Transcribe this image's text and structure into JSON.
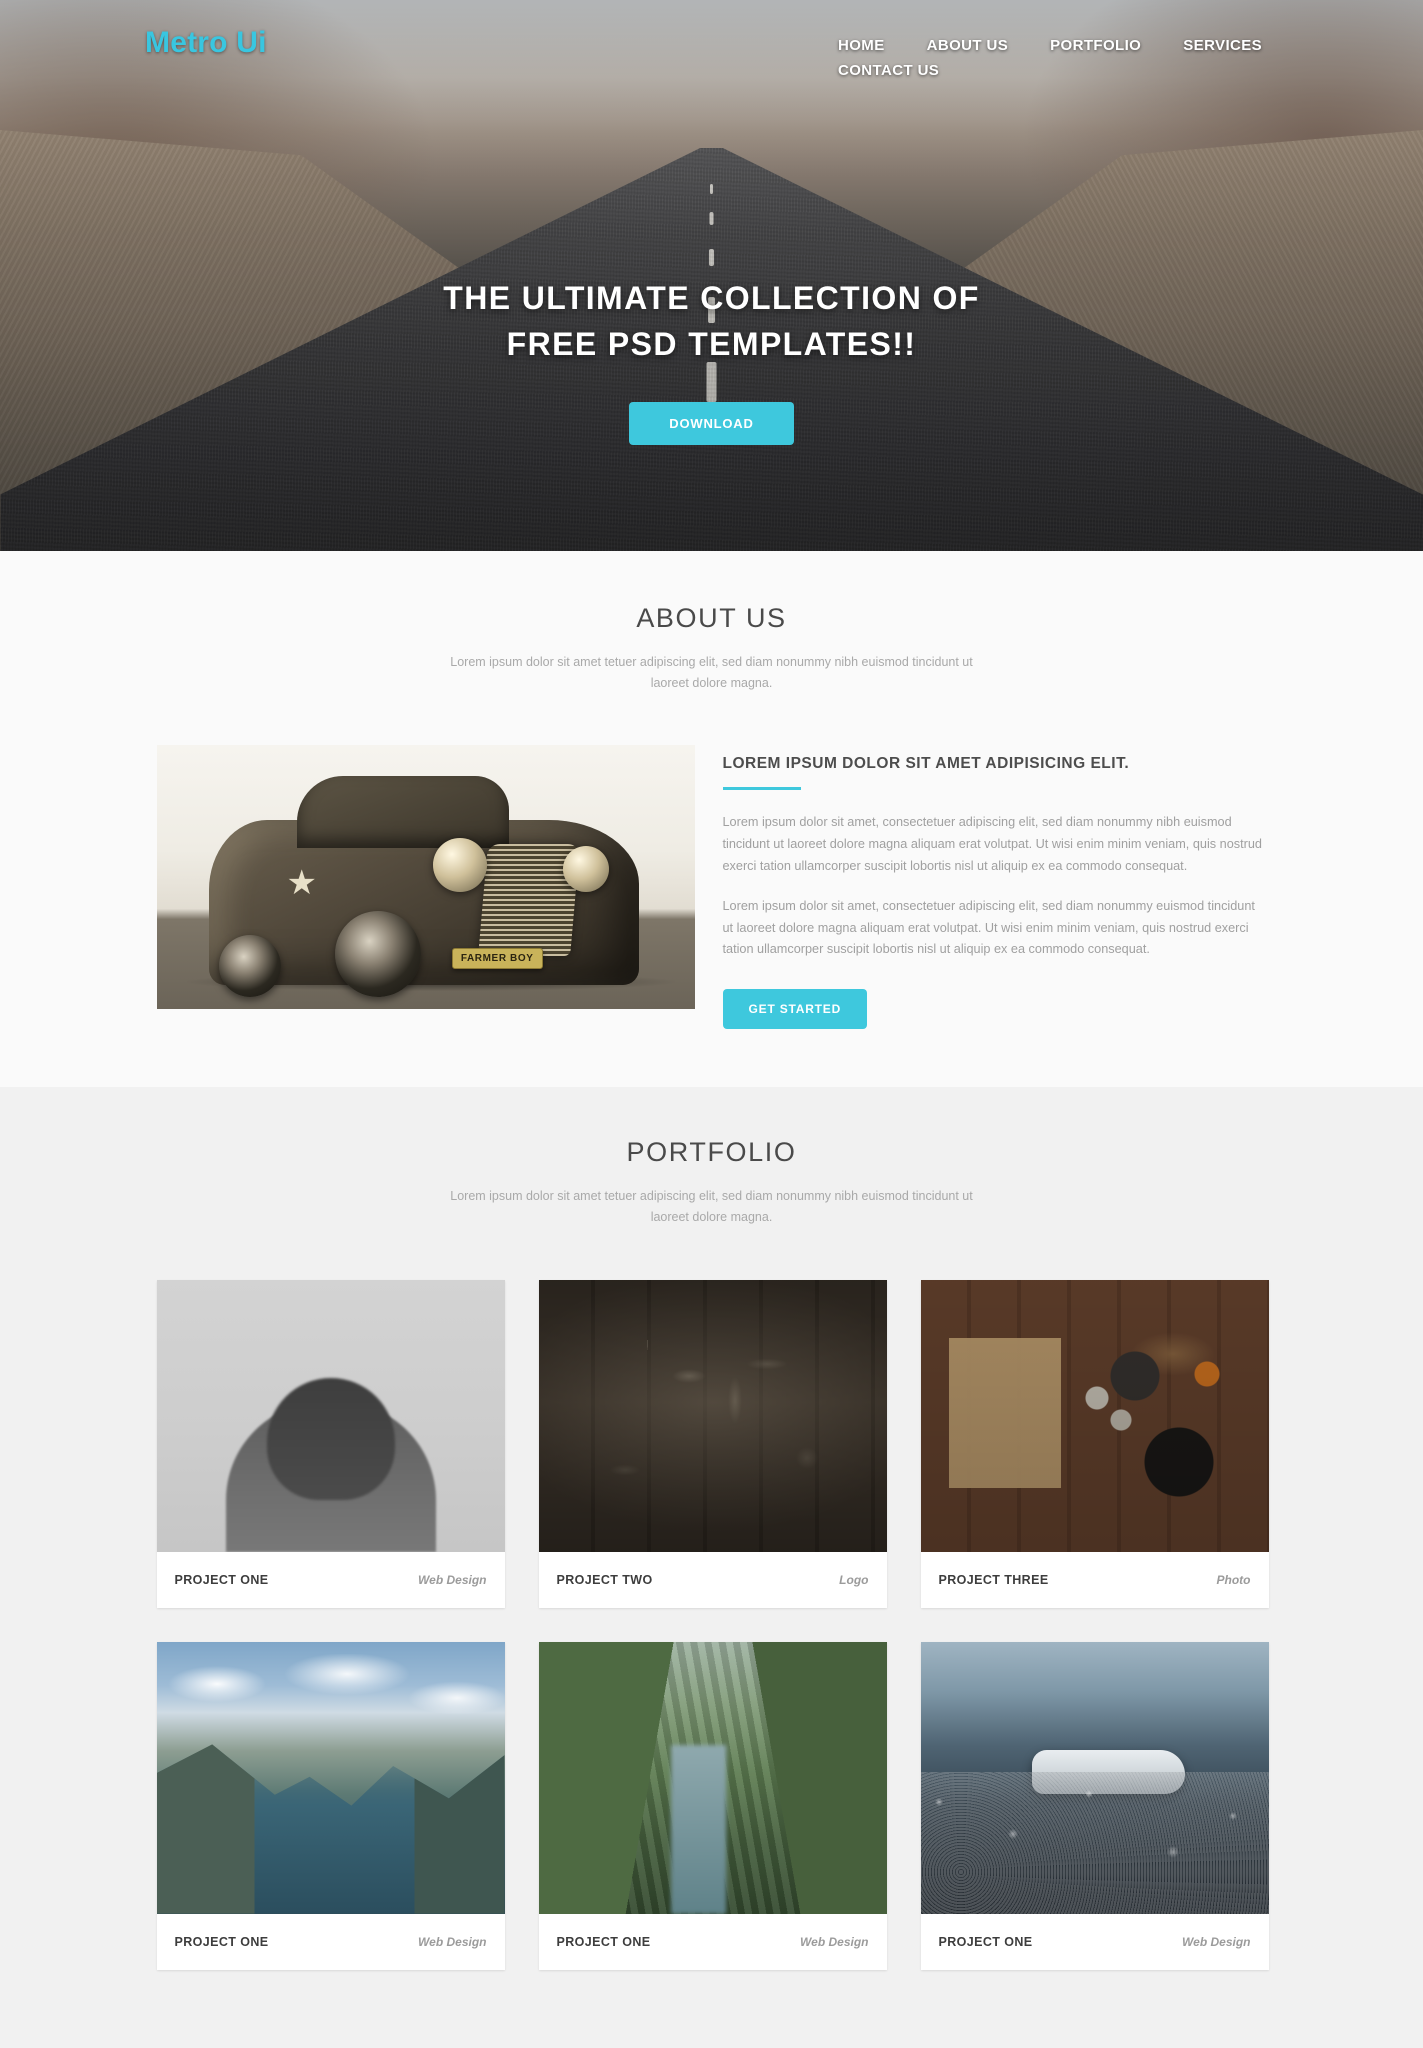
{
  "site": {
    "brand": "Metro Ui",
    "accent_color": "#3ec8dd",
    "nav": [
      {
        "label": "HOME"
      },
      {
        "label": "ABOUT US"
      },
      {
        "label": "PORTFOLIO"
      },
      {
        "label": "SERVICES"
      },
      {
        "label": "CONTACT US"
      }
    ]
  },
  "hero": {
    "title_line1": "THE ULTIMATE COLLECTION OF",
    "title_line2": "FREE PSD TEMPLATES!!",
    "cta_label": "DOWNLOAD"
  },
  "about": {
    "title": "ABOUT US",
    "subtitle": "Lorem ipsum dolor sit amet tetuer adipiscing elit, sed diam nonummy nibh euismod tincidunt ut laoreet dolore magna.",
    "image_caption": "FARMER BOY",
    "heading": "LOREM IPSUM DOLOR SIT AMET ADIPISICING ELIT.",
    "paragraph1": "Lorem ipsum dolor sit amet, consectetuer adipiscing elit, sed diam nonummy nibh euismod tincidunt ut laoreet dolore magna aliquam erat volutpat. Ut wisi enim minim veniam, quis nostrud exerci tation ullamcorper suscipit lobortis nisl ut aliquip ex ea commodo consequat.",
    "paragraph2": "Lorem ipsum dolor sit amet, consectetuer adipiscing elit, sed diam nonummy euismod tincidunt ut laoreet dolore magna aliquam erat volutpat. Ut wisi enim minim veniam, quis nostrud exerci tation ullamcorper suscipit lobortis nisl ut aliquip ex ea commodo consequat.",
    "cta_label": "GET STARTED"
  },
  "portfolio": {
    "title": "PORTFOLIO",
    "subtitle": "Lorem ipsum dolor sit amet tetuer adipiscing elit, sed diam nonummy nibh euismod tincidunt ut laoreet dolore magna.",
    "items": [
      {
        "name": "PROJECT ONE",
        "tag": "Web Design",
        "art": "t-portrait"
      },
      {
        "name": "PROJECT TWO",
        "tag": "Logo",
        "art": "t-tools"
      },
      {
        "name": "PROJECT THREE",
        "tag": "Photo",
        "art": "t-kitchen"
      },
      {
        "name": "PROJECT ONE",
        "tag": "Web Design",
        "art": "t-fjord"
      },
      {
        "name": "PROJECT ONE",
        "tag": "Web Design",
        "art": "t-canyon"
      },
      {
        "name": "PROJECT ONE",
        "tag": "Web Design",
        "art": "t-wreck"
      }
    ]
  }
}
